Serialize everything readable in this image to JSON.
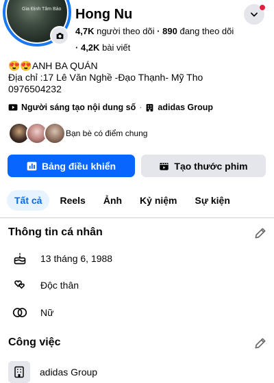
{
  "profile": {
    "name": "Hong Nu",
    "avatar_caption": "Gia Định Tâm Bảo",
    "followers_count": "4,7K",
    "followers_label": "người theo dõi",
    "following_count": "890",
    "following_label": "đang theo dõi",
    "posts_count": "4,2K",
    "posts_label": "bài viết",
    "separator": "·"
  },
  "bio": {
    "line1": "😍😍ANH BA QUÁN",
    "line2": "Địa chỉ :17 Lê Văn Nghề -Đạo Thạnh- Mỹ Tho",
    "line3": "0976504232"
  },
  "meta": {
    "creator_label": "Người sáng tạo nội dung số",
    "work_label": "adidas Group"
  },
  "friends": {
    "label": "Bạn bè có điểm chung"
  },
  "actions": {
    "dashboard": "Bảng điều khiển",
    "create_reel": "Tạo thước phim"
  },
  "tabs": [
    {
      "label": "Tất cả",
      "active": true
    },
    {
      "label": "Reels",
      "active": false
    },
    {
      "label": "Ảnh",
      "active": false
    },
    {
      "label": "Kỷ niệm",
      "active": false
    },
    {
      "label": "Sự kiện",
      "active": false
    }
  ],
  "personal_info": {
    "title": "Thông tin cá nhân",
    "birthday": "13 tháng 6, 1988",
    "relationship": "Độc thân",
    "gender": "Nữ"
  },
  "work": {
    "title": "Công việc",
    "company": "adidas Group"
  },
  "colors": {
    "accent": "#0866ff",
    "tab_active_bg": "#e7f3ff",
    "secondary_bg": "#e4e6eb",
    "notification_dot": "#e41e3f"
  },
  "icons": [
    "camera-icon",
    "chevron-down-icon",
    "video-icon",
    "building-icon",
    "bar-chart-icon",
    "clapperboard-icon",
    "pencil-icon",
    "cake-icon",
    "hearts-icon",
    "gender-icon"
  ]
}
